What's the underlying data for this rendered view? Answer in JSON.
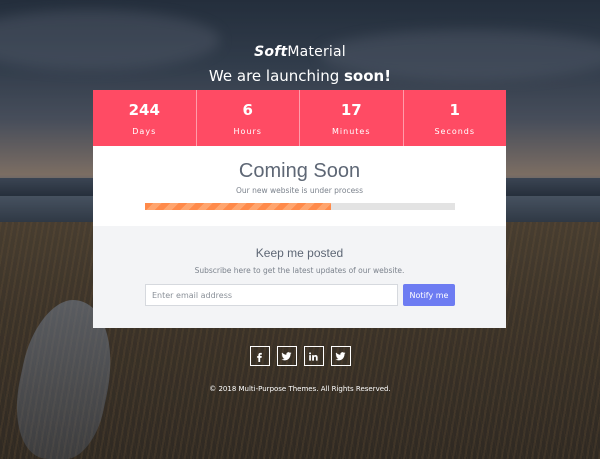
{
  "brand": {
    "bold": "Soft",
    "regular": "Material"
  },
  "tagline": {
    "prefix": "We are launching ",
    "bold": "soon!"
  },
  "countdown": [
    {
      "value": "244",
      "label": "Days"
    },
    {
      "value": "6",
      "label": "Hours"
    },
    {
      "value": "17",
      "label": "Minutes"
    },
    {
      "value": "1",
      "label": "Seconds"
    }
  ],
  "main": {
    "heading": "Coming Soon",
    "subheading": "Our new website is under process",
    "progress_fraction": 0.6
  },
  "subscribe": {
    "title": "Keep me posted",
    "description": "Subscribe here to get the latest updates of our website.",
    "email_placeholder": "Enter email address",
    "button_label": "Notify me"
  },
  "social": [
    {
      "icon": "facebook-icon",
      "glyph": "f"
    },
    {
      "icon": "twitter-icon",
      "glyph": "t"
    },
    {
      "icon": "linkedin-icon",
      "glyph": "in"
    },
    {
      "icon": "twitter-icon",
      "glyph": "t"
    }
  ],
  "footer": {
    "copyright": "© 2018 Multi-Purpose Themes. All Rights Reserved."
  },
  "colors": {
    "countdown_bg": "#ff4b64",
    "progress_fill": "#ff8a4a",
    "button_bg": "#6d7cf2",
    "heading_text": "#5e6775"
  }
}
